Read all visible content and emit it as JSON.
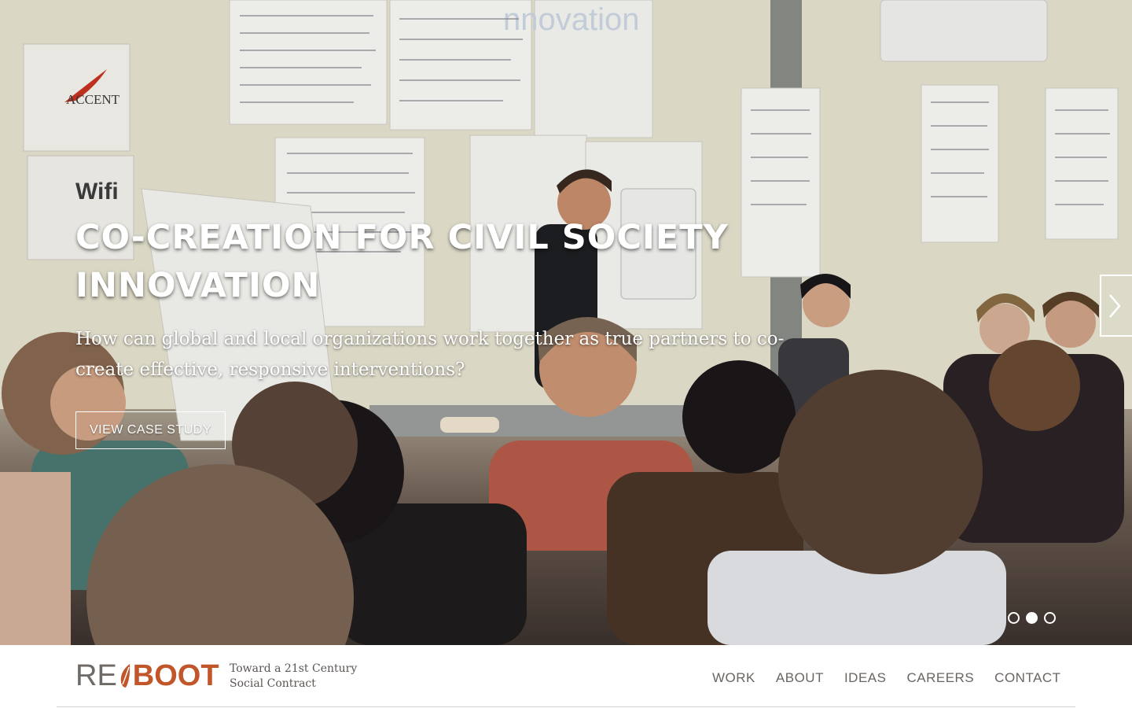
{
  "hero": {
    "title": "CO-CREATION FOR CIVIL SOCIETY INNOVATION",
    "subtitle": "How can global and local organizations work together as true partners to co-create effective, responsive interventions?",
    "cta_label": "VIEW CASE STUDY",
    "next_icon": "chevron-right-icon",
    "slides_total": 3,
    "active_slide": 2
  },
  "header": {
    "logo": {
      "prefix": "RE",
      "suffix": "BOOT",
      "prefix_color": "#6e6a66",
      "accent_color": "#c0562a"
    },
    "tagline": "Toward a 21st Century Social Contract",
    "nav": [
      "WORK",
      "ABOUT",
      "IDEAS",
      "CAREERS",
      "CONTACT"
    ]
  },
  "photo_signs": {
    "poster_1": "ACCENT",
    "poster_2": "Wifi",
    "projection": "nnovation"
  }
}
